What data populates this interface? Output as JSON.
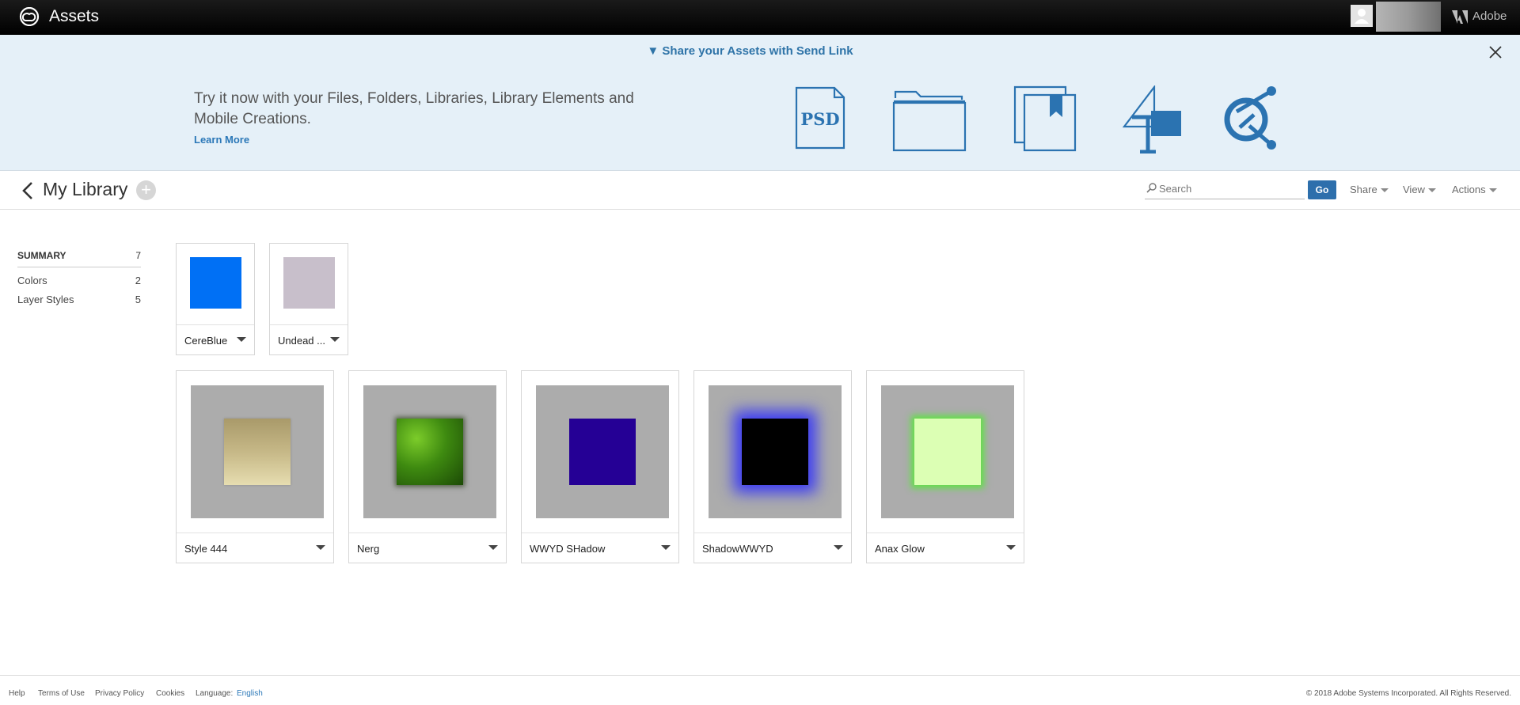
{
  "topbar": {
    "app_title": "Assets",
    "brand": "Adobe"
  },
  "banner": {
    "headline": "▼ Share your Assets with Send Link",
    "text": "Try it now with your Files, Folders, Libraries, Library Elements and Mobile Creations.",
    "learn_more": "Learn More",
    "psd_label": "PSD",
    "icon_color": "#2b73b1"
  },
  "library": {
    "title": "My Library",
    "add_symbol": "+",
    "search_placeholder": "Search",
    "go_label": "Go",
    "menus": [
      "Share",
      "View",
      "Actions"
    ]
  },
  "summary": {
    "heading": "SUMMARY",
    "total": "7",
    "items": [
      {
        "label": "Colors",
        "count": "2"
      },
      {
        "label": "Layer Styles",
        "count": "5"
      }
    ]
  },
  "colors": [
    {
      "name": "CereBlue",
      "hex": "#0070f5"
    },
    {
      "name": "Undead ...",
      "hex": "#c8bfcb"
    }
  ],
  "layer_styles": [
    {
      "name": "Style 444",
      "style": "gold"
    },
    {
      "name": "Nerg",
      "style": "green-texture"
    },
    {
      "name": "WWYD SHadow",
      "style": "indigo"
    },
    {
      "name": "ShadowWWYD",
      "style": "black-blue-glow"
    },
    {
      "name": "Anax Glow",
      "style": "green-glow"
    }
  ],
  "footer": {
    "links": [
      "Help",
      "Terms of Use",
      "Privacy Policy",
      "Cookies"
    ],
    "language_label": "Language:",
    "language": "English",
    "copyright": "© 2018 Adobe Systems Incorporated. All Rights Reserved."
  }
}
